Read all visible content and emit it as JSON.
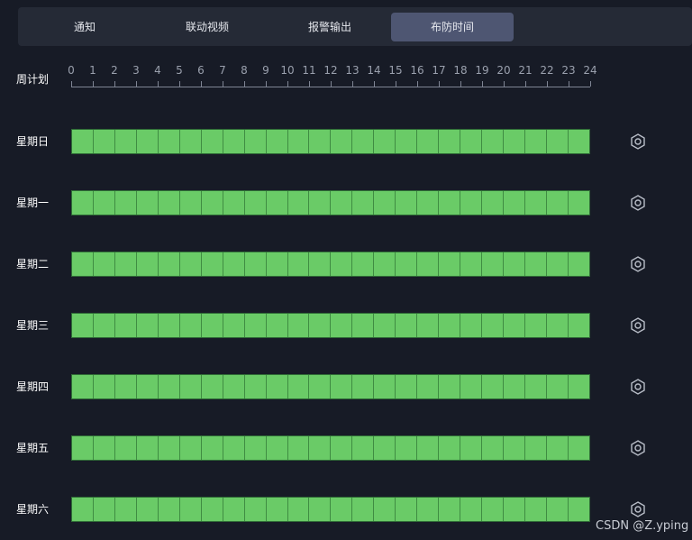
{
  "tabs": [
    {
      "label": "通知",
      "active": false
    },
    {
      "label": "联动视频",
      "active": false
    },
    {
      "label": "报警输出",
      "active": false
    },
    {
      "label": "布防时间",
      "active": true
    }
  ],
  "schedule": {
    "title": "周计划",
    "hours": [
      "0",
      "1",
      "2",
      "3",
      "4",
      "5",
      "6",
      "7",
      "8",
      "9",
      "10",
      "11",
      "12",
      "13",
      "14",
      "15",
      "16",
      "17",
      "18",
      "19",
      "20",
      "21",
      "22",
      "23",
      "24"
    ],
    "armed_color": "#6acb67",
    "days": [
      {
        "label": "星期日",
        "armed_hours": [
          0,
          1,
          2,
          3,
          4,
          5,
          6,
          7,
          8,
          9,
          10,
          11,
          12,
          13,
          14,
          15,
          16,
          17,
          18,
          19,
          20,
          21,
          22,
          23
        ]
      },
      {
        "label": "星期一",
        "armed_hours": [
          0,
          1,
          2,
          3,
          4,
          5,
          6,
          7,
          8,
          9,
          10,
          11,
          12,
          13,
          14,
          15,
          16,
          17,
          18,
          19,
          20,
          21,
          22,
          23
        ]
      },
      {
        "label": "星期二",
        "armed_hours": [
          0,
          1,
          2,
          3,
          4,
          5,
          6,
          7,
          8,
          9,
          10,
          11,
          12,
          13,
          14,
          15,
          16,
          17,
          18,
          19,
          20,
          21,
          22,
          23
        ]
      },
      {
        "label": "星期三",
        "armed_hours": [
          0,
          1,
          2,
          3,
          4,
          5,
          6,
          7,
          8,
          9,
          10,
          11,
          12,
          13,
          14,
          15,
          16,
          17,
          18,
          19,
          20,
          21,
          22,
          23
        ]
      },
      {
        "label": "星期四",
        "armed_hours": [
          0,
          1,
          2,
          3,
          4,
          5,
          6,
          7,
          8,
          9,
          10,
          11,
          12,
          13,
          14,
          15,
          16,
          17,
          18,
          19,
          20,
          21,
          22,
          23
        ]
      },
      {
        "label": "星期五",
        "armed_hours": [
          0,
          1,
          2,
          3,
          4,
          5,
          6,
          7,
          8,
          9,
          10,
          11,
          12,
          13,
          14,
          15,
          16,
          17,
          18,
          19,
          20,
          21,
          22,
          23
        ]
      },
      {
        "label": "星期六",
        "armed_hours": [
          0,
          1,
          2,
          3,
          4,
          5,
          6,
          7,
          8,
          9,
          10,
          11,
          12,
          13,
          14,
          15,
          16,
          17,
          18,
          19,
          20,
          21,
          22,
          23
        ]
      }
    ],
    "settings_icon": "gear-icon"
  },
  "watermark": "CSDN @Z.yping"
}
